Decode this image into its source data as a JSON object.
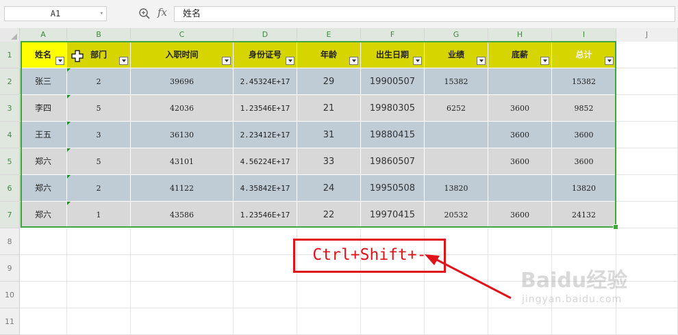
{
  "formula_bar": {
    "name_box": "A1",
    "fx_label": "fx",
    "formula_value": "姓名"
  },
  "columns": [
    "A",
    "B",
    "C",
    "D",
    "E",
    "F",
    "G",
    "H",
    "I",
    "J"
  ],
  "rows": [
    "1",
    "2",
    "3",
    "4",
    "5",
    "6",
    "7",
    "8",
    "9",
    "10",
    "11"
  ],
  "table": {
    "headers": [
      "姓名",
      "部门",
      "入职时间",
      "身份证号",
      "年龄",
      "出生日期",
      "业绩",
      "底薪",
      "总计"
    ],
    "data": [
      [
        "张三",
        "2",
        "39696",
        "2.45324E+17",
        "29",
        "19900507",
        "15382",
        "",
        "15382"
      ],
      [
        "李四",
        "5",
        "42036",
        "1.23546E+17",
        "21",
        "19980305",
        "6252",
        "3600",
        "9852"
      ],
      [
        "王五",
        "3",
        "36130",
        "2.23412E+17",
        "31",
        "19880415",
        "",
        "3600",
        "3600"
      ],
      [
        "郑六",
        "5",
        "43101",
        "4.56224E+17",
        "33",
        "19860507",
        "",
        "3600",
        "3600"
      ],
      [
        "郑六",
        "2",
        "41122",
        "4.35842E+17",
        "24",
        "19950508",
        "13820",
        "",
        "13820"
      ],
      [
        "郑六",
        "1",
        "43586",
        "1.23546E+17",
        "22",
        "19970415",
        "20532",
        "3600",
        "24132"
      ]
    ]
  },
  "annotation": {
    "text": "Ctrl+Shift+-"
  },
  "watermark": {
    "logo": "Baidu经验",
    "url": "jingyan.baidu.com"
  },
  "colors": {
    "header_bg": "#d6d500",
    "header_name_bg": "#fefe00",
    "row_blue": "#bfccd5",
    "row_gray": "#d8d8d8",
    "selection": "#3fa63f",
    "annotation": "#e0131b"
  }
}
